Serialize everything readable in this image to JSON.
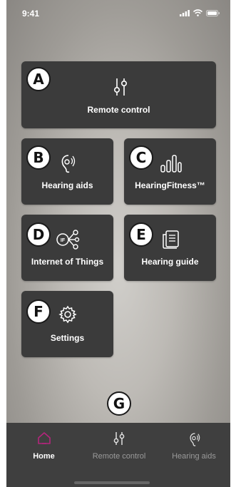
{
  "status_bar": {
    "time": "9:41"
  },
  "tiles": {
    "remote_control": {
      "label": "Remote control",
      "badge": "A"
    },
    "hearing_aids": {
      "label": "Hearing aids",
      "badge": "B"
    },
    "hearing_fitness": {
      "label": "HearingFitness™",
      "badge": "C"
    },
    "iot": {
      "label": "Internet of Things",
      "badge": "D",
      "icon_text": "IF"
    },
    "hearing_guide": {
      "label": "Hearing guide",
      "badge": "E"
    },
    "settings": {
      "label": "Settings",
      "badge": "F"
    }
  },
  "callout_g": "G",
  "tab_bar": {
    "items": [
      {
        "label": "Home",
        "icon": "home-icon",
        "active": true
      },
      {
        "label": "Remote control",
        "icon": "sliders-icon",
        "active": false
      },
      {
        "label": "Hearing aids",
        "icon": "hearing-aid-icon",
        "active": false
      }
    ]
  },
  "colors": {
    "tile_bg": "#3b3b3b",
    "tab_bar_bg": "#3f3f3f",
    "active_tab_icon": "#b4257c"
  }
}
